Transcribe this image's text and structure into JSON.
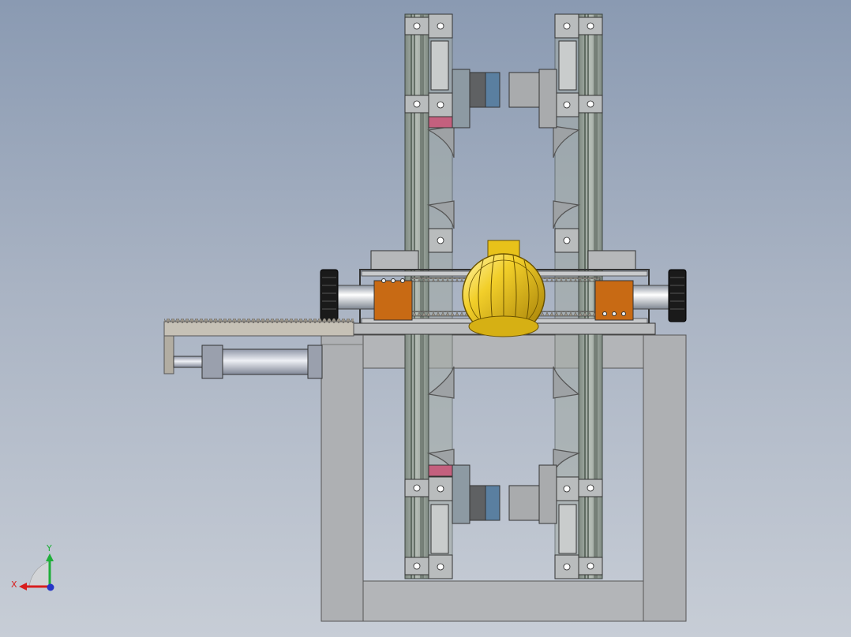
{
  "view": {
    "background_top": "#8a9ab2",
    "background_bottom": "#c7cdd6"
  },
  "triad": {
    "x_label": "X",
    "y_label": "Y",
    "x_color": "#d81e1e",
    "y_color": "#1fae3a",
    "z_color": "#2636c8"
  },
  "colors": {
    "frame": "#aeb0b3",
    "frame_dark": "#8e9093",
    "rail": "#9aa29c",
    "ball": "#e8c21a",
    "block_orange": "#c86a14",
    "block_pink": "#c4607e",
    "block_blue": "#5a7fa0",
    "block_dark": "#5f6163",
    "knob": "#1a1a1a",
    "cylinder": "#c9cdd6"
  }
}
